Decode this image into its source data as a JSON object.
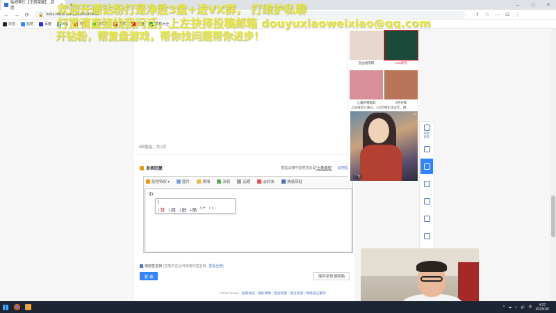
{
  "browser": {
    "tab_title": "贴吧帮忙【王牌荣耀】_百度",
    "tab_close": "×",
    "new_tab": "+",
    "url": "tieba.baidu.com/p/8209665561",
    "window_controls": [
      "–",
      "□",
      "×"
    ],
    "nav": {
      "back": "←",
      "forward": "→",
      "reload": "⟳"
    },
    "addr_icons": [
      "⇪",
      "☆",
      "⋯",
      "⊡",
      "⋮"
    ],
    "bookmarks": [
      {
        "label": "抖音",
        "color": "#222222"
      },
      {
        "label": "贴吧",
        "color": "#3385ff"
      },
      {
        "label": "百度",
        "color": "#2932e1"
      },
      {
        "label": "B站",
        "color": "#00a1d6"
      },
      {
        "label": "淘宝",
        "color": "#ff5000"
      },
      {
        "label": "爱奇艺",
        "color": "#00be06"
      },
      {
        "label": "京东",
        "color": "#e1251b"
      },
      {
        "label": "天猫",
        "color": "#ff0036"
      },
      {
        "label": "机构大全",
        "color": "#1ba784"
      }
    ]
  },
  "overlay": {
    "line1": "欢迎开通钻粉打是净胜3盘+进VX群，   打维护私聊",
    "line2": "打赏请直接找我问话，上左抉择投稿邮箱 douyuxiaoweixiao@qq.com",
    "line3": "开钻粉，帮复盘游戏，帮你找问题帮你进步！"
  },
  "post": {
    "reply_count": "0回复贴，共1页",
    "reply_section_title": "发表回复",
    "reply_right_text": "发贴请遵守贴吧协议及",
    "reply_right_link": "\"七条底线\"",
    "reply_right_link2": "贴吧投诉",
    "toolbar": [
      {
        "label": "贴吧特权 ▾",
        "color": "#f39800"
      },
      {
        "label": "图片",
        "color": "#7aa1d9"
      },
      {
        "label": "表情",
        "color": "#f6b73c"
      },
      {
        "label": "涂鸦",
        "color": "#5aa95a"
      },
      {
        "label": "话题",
        "color": "#9aa0a8"
      },
      {
        "label": "@好友",
        "color": "#e5534b"
      },
      {
        "label": "快速回贴",
        "color": "#4a73c3"
      }
    ],
    "editor_text": "ID:",
    "ime": {
      "composition": "j",
      "candidates": [
        {
          "num": "1",
          "text": "就"
        },
        {
          "num": "2",
          "text": "间"
        },
        {
          "num": "3",
          "text": "进"
        },
        {
          "num": "4",
          "text": "局"
        },
        {
          "num": "5",
          "text": "+"
        }
      ],
      "nav": "‹ ›"
    },
    "signature_label": "使用签名档",
    "signature_hint": "(您暂时还没可使用的签名档,",
    "signature_link": "查看全部)",
    "send_button": "发 表",
    "save_button": "保存至快速回贴",
    "footer": {
      "copyright": "©2023 Baidu",
      "links": [
        "贴吧协议",
        "隐私政策",
        "吧主制度",
        "意见反馈",
        "网络谣言警示"
      ]
    }
  },
  "ads": {
    "cells": [
      {
        "caption": "自由组限网",
        "red": false,
        "color": "#e9d6cc"
      },
      {
        "caption": "vivo系列",
        "red": true,
        "color": "#1c4a3a"
      },
      {
        "caption": "儿童护眼面具",
        "red": false,
        "color": "#d98f9a"
      },
      {
        "caption": "5月分摊",
        "red": false,
        "color": "#b8755a"
      }
    ],
    "text_line": "上核道四大满分，100年精彩走过年，精",
    "game_ad_tag": "广告",
    "game_ad_close": "×"
  },
  "float_bar": [
    {
      "label": "帖助\n推荐",
      "active": false
    },
    {
      "label": "",
      "active": false
    },
    {
      "label": "",
      "active": true
    },
    {
      "label": "",
      "active": false
    },
    {
      "label": "",
      "active": false
    },
    {
      "label": "",
      "active": false
    },
    {
      "label": "",
      "active": false
    }
  ],
  "taskbar": {
    "time": "4:27",
    "date": "2023/1/5",
    "tray_icons": [
      "^",
      "☁",
      "◐",
      "🔊",
      "中"
    ]
  }
}
